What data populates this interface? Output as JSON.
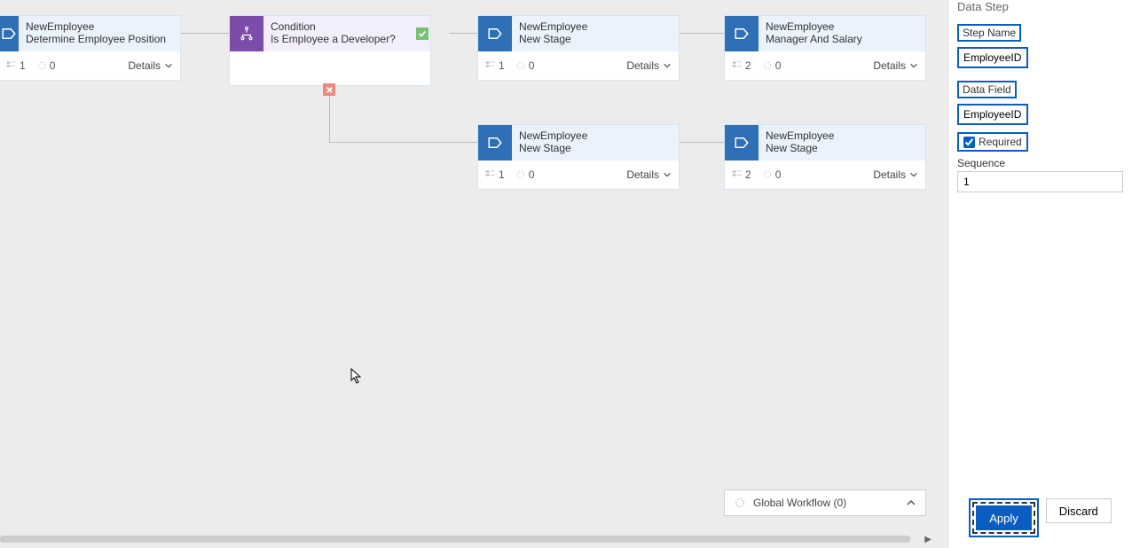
{
  "canvas": {
    "halfstage": {
      "entity": "NewEmployee",
      "name": "Determine Employee Position",
      "steps": "1",
      "wf": "0",
      "details": "Details"
    },
    "condition": {
      "entity": "Condition",
      "name": "Is Employee a Developer?"
    },
    "stageA": {
      "entity": "NewEmployee",
      "name": "New Stage",
      "steps": "1",
      "wf": "0",
      "details": "Details"
    },
    "stageB": {
      "entity": "NewEmployee",
      "name": "Manager And Salary",
      "steps": "2",
      "wf": "0",
      "details": "Details"
    },
    "stageC": {
      "entity": "NewEmployee",
      "name": "New Stage",
      "steps": "1",
      "wf": "0",
      "details": "Details"
    },
    "stageD": {
      "entity": "NewEmployee",
      "name": "New Stage",
      "steps": "2",
      "wf": "0",
      "details": "Details"
    },
    "globalWorkflow": "Global Workflow (0)"
  },
  "sidebar": {
    "panelTitle": "Data Step",
    "stepNameLabel": "Step Name",
    "stepNameValue": "EmployeeID",
    "dataFieldLabel": "Data Field",
    "dataFieldValue": "EmployeeID",
    "requiredLabel": "Required",
    "sequenceLabel": "Sequence",
    "sequenceValue": "1",
    "applyLabel": "Apply",
    "discardLabel": "Discard"
  }
}
